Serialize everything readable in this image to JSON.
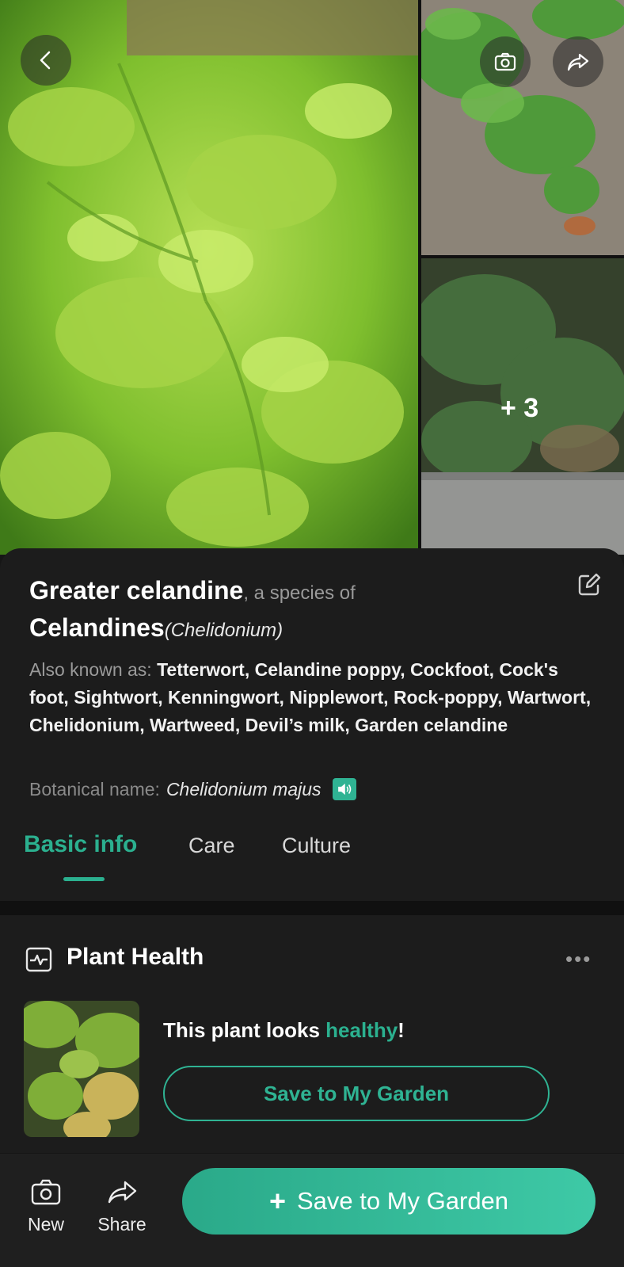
{
  "gallery": {
    "more_count": "+ 3",
    "icons": {
      "back": "chevron-left-icon",
      "camera": "camera-icon",
      "share": "share-arrow-icon"
    }
  },
  "plant": {
    "common_name": "Greater celandine",
    "species_of_text": ", a species of",
    "genus_common": "Celandines",
    "genus_latin": "(Chelidonium)",
    "aka_label": "Also known as: ",
    "aka_value": "Tetterwort, Celandine poppy, Cockfoot, Cock's foot, Sightwort, Kenningwort, Nipplewort, Rock-poppy, Wartwort, Chelidonium, Wartweed, Devil’s milk, Garden celandine",
    "botanical_label": "Botanical name:",
    "botanical_name": "Chelidonium majus"
  },
  "tabs": [
    {
      "label": "Basic info",
      "active": true
    },
    {
      "label": "Care",
      "active": false
    },
    {
      "label": "Culture",
      "active": false
    }
  ],
  "health": {
    "title": "Plant Health",
    "menu": "•••",
    "status_prefix": "This plant looks ",
    "status_word": "healthy",
    "status_suffix": "!",
    "save_button": "Save to My Garden"
  },
  "bottom_bar": {
    "new_label": "New",
    "share_label": "Share",
    "primary_plus": "+",
    "primary_label": "Save to My Garden"
  },
  "colors": {
    "accent": "#2bb08f",
    "background": "#1c1c1c"
  }
}
